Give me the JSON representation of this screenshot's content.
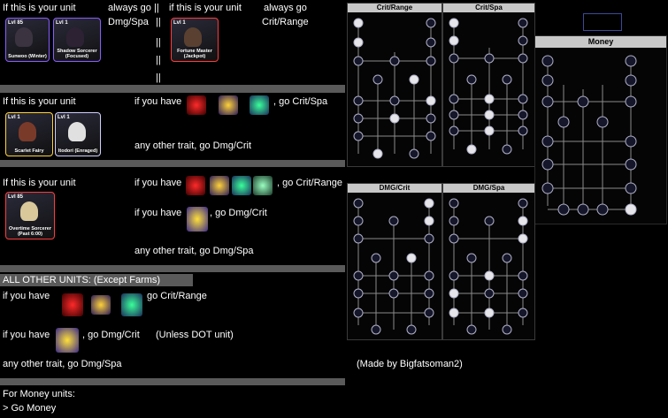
{
  "section1": {
    "left_text": "If this is your unit",
    "left_always": "always go",
    "left_stat": "Dmg/Spa",
    "right_text": "if this is your unit",
    "right_always": "always go",
    "right_stat": "Crit/Range",
    "sep1": "||",
    "sep2": "||",
    "sep3": "||",
    "sep4": "||",
    "sep5": "||",
    "units_left": [
      {
        "level": "Lvl 85",
        "name": "Sunwoo (Winter)"
      },
      {
        "level": "Lvl 1",
        "name": "Shadow Sorcerer (Focused)"
      }
    ],
    "units_right": [
      {
        "level": "Lvl 1",
        "name": "Fortune Master (Jackpot)"
      }
    ]
  },
  "section2": {
    "text": "If this is your unit",
    "if_have": "if you have",
    "result": ", go Crit/Spa",
    "other": "any other trait, go Dmg/Crit",
    "units": [
      {
        "level": "Lvl 1",
        "name": "Scarlet Fairy"
      },
      {
        "level": "Lvl 1",
        "name": "Itodori (Enraged)"
      }
    ]
  },
  "section3": {
    "text": "If this is your unit",
    "if_have": "if you have",
    "result": ", go Crit/Range",
    "if_have2": "if you have",
    "result2": ", go Dmg/Crit",
    "other": "any other trait, go Dmg/Spa",
    "units": [
      {
        "level": "Lvl 85",
        "name": "Overtime Sorcerer (Past 6:00)"
      }
    ]
  },
  "section4": {
    "header": "ALL OTHER UNITS: (Except Farms)",
    "if_have": "if you have",
    "result": "go Crit/Range",
    "if_have2": "if you have",
    "result2": ", go Dmg/Crit",
    "note": "(Unless DOT unit)",
    "other": "any other trait, go Dmg/Spa",
    "credit": "(Made by Bigfatsoman2)"
  },
  "section5": {
    "line1": "For Money units:",
    "line2": "> Go Money"
  },
  "trees": {
    "crit_range": "Crit/Range",
    "crit_spa": "Crit/Spa",
    "money": "Money",
    "dmg_crit": "DMG/Crit",
    "dmg_spa": "DMG/Spa"
  },
  "colors": {
    "divider": "#5a5a5a",
    "node_on": "#e6e6ea",
    "node_off": "#16162a",
    "panel_header": "#c8c8c8"
  }
}
